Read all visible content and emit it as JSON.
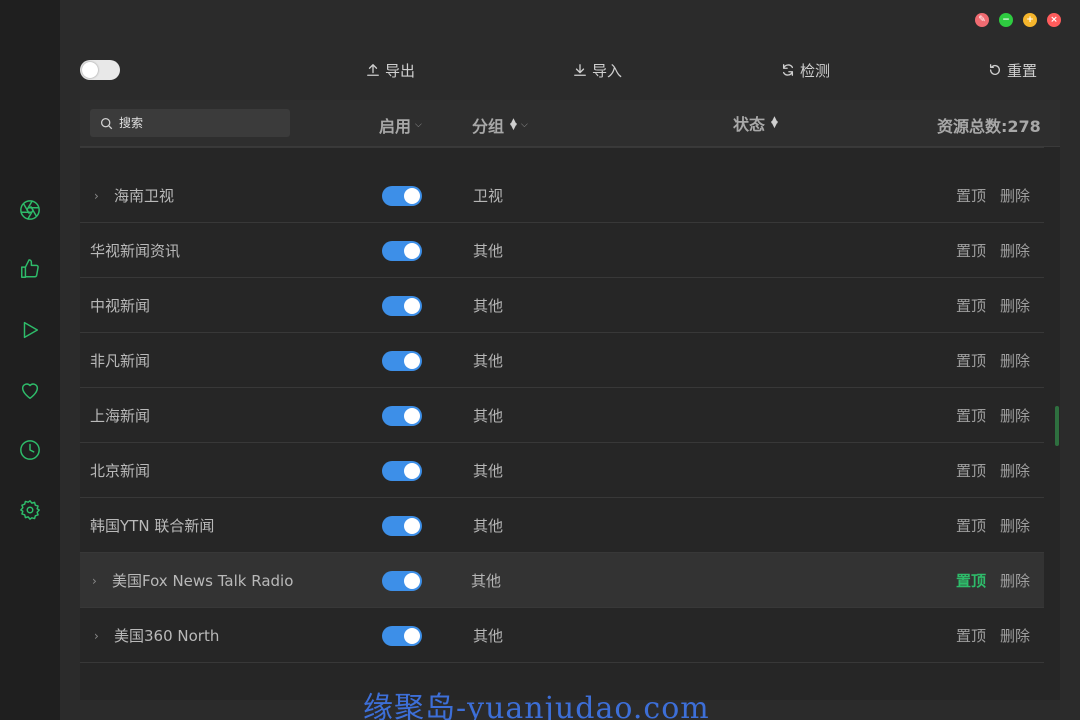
{
  "window_controls": {
    "colors": [
      "#f06b71",
      "#2ecc40",
      "#f5b52c",
      "#ff5c5c"
    ],
    "icons": [
      "pin-icon",
      "minimize-icon",
      "maximize-icon",
      "close-icon"
    ]
  },
  "sidebar": {
    "items": [
      "aperture-icon",
      "thumbs-up-icon",
      "play-icon",
      "heart-icon",
      "clock-icon",
      "gear-icon"
    ],
    "accent": "#2ebc6a"
  },
  "toolbar": {
    "export_label": "导出",
    "import_label": "导入",
    "check_label": "检测",
    "reset_label": "重置"
  },
  "table": {
    "search_placeholder": "搜索",
    "col_enabled": "启用",
    "col_group": "分组",
    "col_status": "状态",
    "total_label": "资源总数:278",
    "rows": [
      {
        "name": "海南卫视",
        "group": "卫视",
        "expandable": true
      },
      {
        "name": "华视新闻资讯",
        "group": "其他",
        "expandable": false
      },
      {
        "name": "中视新闻",
        "group": "其他",
        "expandable": false
      },
      {
        "name": "非凡新闻",
        "group": "其他",
        "expandable": false
      },
      {
        "name": "上海新闻",
        "group": "其他",
        "expandable": false
      },
      {
        "name": "北京新闻",
        "group": "其他",
        "expandable": false
      },
      {
        "name": "韩国YTN 联合新闻",
        "group": "其他",
        "expandable": false
      },
      {
        "name": "美国Fox News Talk Radio",
        "group": "其他",
        "expandable": true
      },
      {
        "name": "美国360 North",
        "group": "其他",
        "expandable": true
      }
    ],
    "pin_label": "置顶",
    "delete_label": "删除",
    "switch_color": "#3d8fe8"
  },
  "watermark": "缘聚岛-yuanjudao.com"
}
